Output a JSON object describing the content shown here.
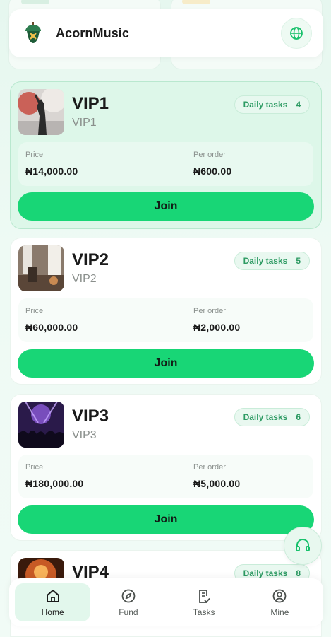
{
  "app": {
    "title": "AcornMusic"
  },
  "colors": {
    "accent": "#18d676",
    "accent_text": "#2c9a62",
    "highlight_bg": "#ddf7e9"
  },
  "currency": "₦",
  "vip_cards": [
    {
      "name": "VIP1",
      "subtitle": "VIP1",
      "badge_label": "Daily tasks",
      "daily_tasks": "4",
      "price_label": "Price",
      "price": "₦14,000.00",
      "per_order_label": "Per order",
      "per_order": "₦600.00",
      "join_label": "Join",
      "image": "concert-performer-photo"
    },
    {
      "name": "VIP2",
      "subtitle": "VIP2",
      "badge_label": "Daily tasks",
      "daily_tasks": "5",
      "price_label": "Price",
      "price": "₦60,000.00",
      "per_order_label": "Per order",
      "per_order": "₦2,000.00",
      "join_label": "Join",
      "image": "studio-room-photo"
    },
    {
      "name": "VIP3",
      "subtitle": "VIP3",
      "badge_label": "Daily tasks",
      "daily_tasks": "6",
      "price_label": "Price",
      "price": "₦180,000.00",
      "per_order_label": "Per order",
      "per_order": "₦5,000.00",
      "join_label": "Join",
      "image": "concert-crowd-photo"
    },
    {
      "name": "VIP4",
      "subtitle": "",
      "badge_label": "Daily tasks",
      "daily_tasks": "8",
      "image": "fire-stage-photo"
    }
  ],
  "nav": [
    {
      "label": "Home",
      "icon": "home-icon",
      "active": true
    },
    {
      "label": "Fund",
      "icon": "compass-icon",
      "active": false
    },
    {
      "label": "Tasks",
      "icon": "clipboard-check-icon",
      "active": false
    },
    {
      "label": "Mine",
      "icon": "user-circle-icon",
      "active": false
    }
  ]
}
